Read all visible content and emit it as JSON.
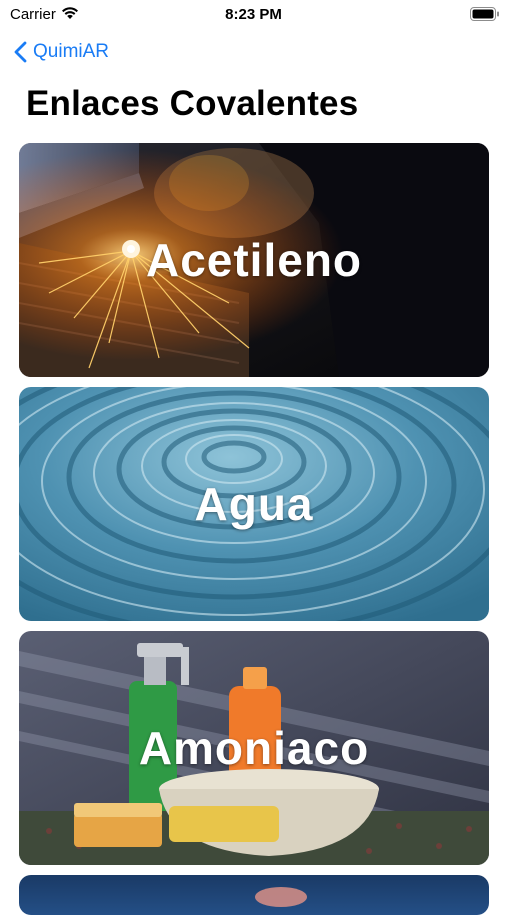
{
  "status_bar": {
    "carrier": "Carrier",
    "time": "8:23 PM"
  },
  "nav": {
    "back_label": "QuimiAR"
  },
  "page": {
    "title": "Enlaces Covalentes"
  },
  "cards": [
    {
      "label": "Acetileno"
    },
    {
      "label": "Agua"
    },
    {
      "label": "Amoniaco"
    },
    {
      "label": ""
    }
  ],
  "colors": {
    "accent": "#1a7cf5"
  }
}
